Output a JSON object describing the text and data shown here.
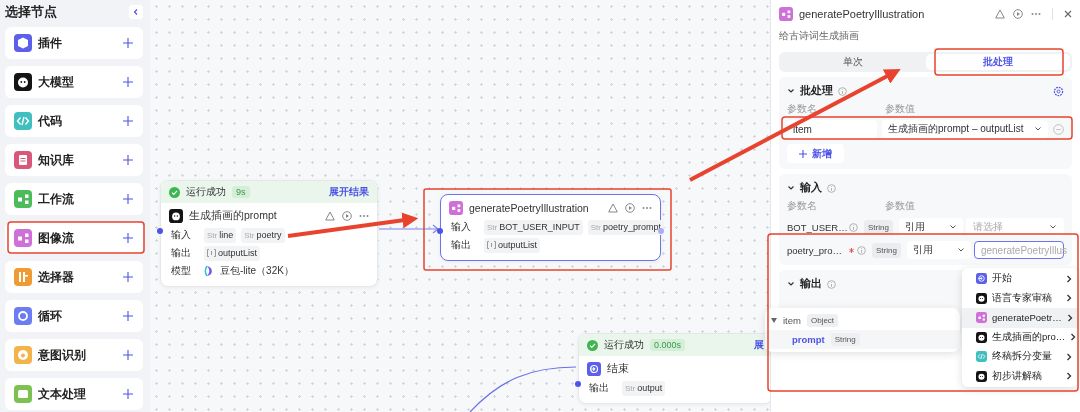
{
  "sidebar": {
    "title": "选择节点",
    "items": [
      {
        "label": "插件",
        "kind": "plugin"
      },
      {
        "label": "大模型",
        "kind": "llm"
      },
      {
        "label": "代码",
        "kind": "code"
      },
      {
        "label": "知识库",
        "kind": "knowledge"
      },
      {
        "label": "工作流",
        "kind": "workflow"
      },
      {
        "label": "图像流",
        "kind": "imageflow"
      },
      {
        "label": "选择器",
        "kind": "selector"
      },
      {
        "label": "循环",
        "kind": "loop"
      },
      {
        "label": "意图识别",
        "kind": "intent"
      },
      {
        "label": "文本处理",
        "kind": "text"
      }
    ]
  },
  "canvas": {
    "nodes": [
      {
        "kind": "llm",
        "title": "生成插画的prompt",
        "selected": false,
        "toolbar": true,
        "status": {
          "label": "运行成功",
          "time": "9s",
          "action": "展开结果"
        },
        "rows": [
          {
            "label": "输入",
            "params": [
              {
                "kind": "string",
                "tag": "Str",
                "name": "line"
              },
              {
                "kind": "string",
                "tag": "Str",
                "name": "poetry"
              }
            ]
          },
          {
            "label": "输出",
            "params": [
              {
                "kind": "list",
                "name": "outputList"
              }
            ]
          },
          {
            "label": "模型",
            "model": "豆包-lite（32K）"
          }
        ]
      },
      {
        "kind": "imageflow",
        "title": "generatePoetryIllustration",
        "selected": true,
        "toolbar": true,
        "rows": [
          {
            "label": "输入",
            "params": [
              {
                "kind": "string",
                "tag": "Str",
                "name": "BOT_USER_INPUT"
              },
              {
                "kind": "string",
                "tag": "Str",
                "name": "poetry_prompt"
              }
            ]
          },
          {
            "label": "输出",
            "params": [
              {
                "kind": "list",
                "name": "outputList"
              }
            ]
          }
        ]
      },
      {
        "kind": "end",
        "title": "结束",
        "selected": false,
        "toolbar": false,
        "status": {
          "label": "运行成功",
          "time": "0.000s",
          "action": "展"
        },
        "rows": [
          {
            "label": "输出",
            "params": [
              {
                "kind": "string",
                "tag": "Str",
                "name": "output"
              }
            ]
          }
        ]
      }
    ]
  },
  "panel": {
    "title": "generatePoetryIllustration",
    "subtitle": "给古诗词生成插画",
    "tabs": [
      {
        "label": "单次",
        "selected": false
      },
      {
        "label": "批处理",
        "selected": true
      }
    ],
    "batch": {
      "title": "批处理",
      "expanded": true,
      "columns": [
        "参数名",
        "参数值"
      ],
      "rows": [
        {
          "name": "item",
          "value": "生成插画的prompt – outputList"
        }
      ],
      "add_label": "新增"
    },
    "input": {
      "title": "输入",
      "expanded": true,
      "columns": [
        "参数名",
        "参数值"
      ],
      "rows": [
        {
          "name": "BOT_USER…",
          "required": false,
          "type": "String",
          "source": "引用",
          "placeholder": "请选择",
          "focused": false
        },
        {
          "name": "poetry_pro…",
          "required": true,
          "type": "String",
          "source": "引用",
          "value": "generatePoetryIllus",
          "focused": true
        }
      ]
    },
    "output": {
      "title": "输出",
      "expanded": true
    }
  },
  "popover": {
    "rows": [
      {
        "kind": "parent",
        "name": "item",
        "type": "Object"
      },
      {
        "kind": "child",
        "name": "prompt",
        "type": "String"
      }
    ]
  },
  "menu": {
    "items": [
      {
        "label": "开始",
        "kind": "start",
        "selected": false
      },
      {
        "label": "语言专家审稿",
        "kind": "llm",
        "selected": false
      },
      {
        "label": "generatePoetr…",
        "kind": "imageflow",
        "selected": true
      },
      {
        "label": "生成插画的pro…",
        "kind": "llm",
        "selected": false
      },
      {
        "label": "终稿拆分变量",
        "kind": "code",
        "selected": false
      },
      {
        "label": "初步讲解稿",
        "kind": "llm",
        "selected": false
      }
    ]
  }
}
